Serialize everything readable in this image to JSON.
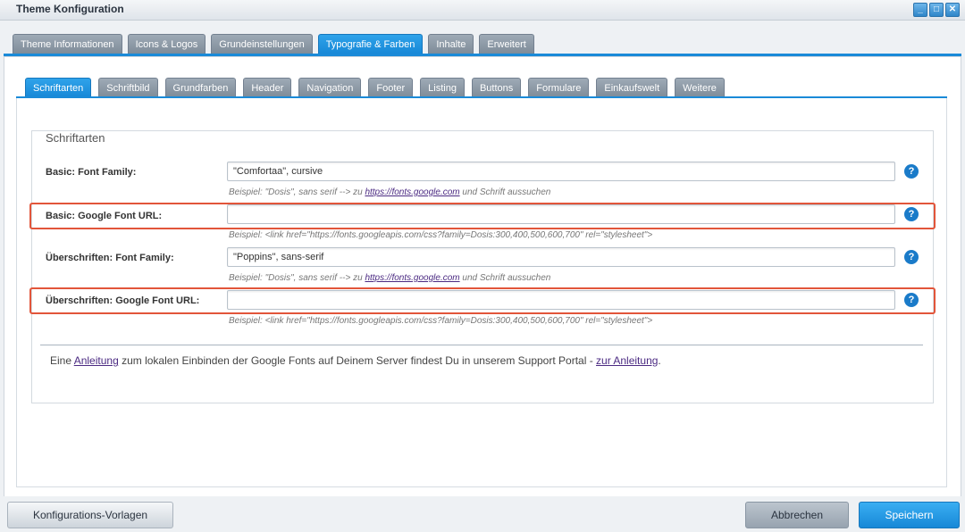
{
  "window": {
    "title": "Theme Konfiguration",
    "controls": [
      "_",
      "□",
      "✕"
    ]
  },
  "main_tabs": [
    "Theme Informationen",
    "Icons & Logos",
    "Grundeinstellungen",
    "Typografie & Farben",
    "Inhalte",
    "Erweitert"
  ],
  "main_tab_active": "Typografie & Farben",
  "sub_tabs": [
    "Schriftarten",
    "Schriftbild",
    "Grundfarben",
    "Header",
    "Navigation",
    "Footer",
    "Listing",
    "Buttons",
    "Formulare",
    "Einkaufswelt",
    "Weitere"
  ],
  "sub_tab_active": "Schriftarten",
  "fieldset_legend": "Schriftarten",
  "fields": [
    {
      "label": "Basic: Font Family:",
      "value": "\"Comfortaa\", cursive",
      "hint_pre": "Beispiel: \"Dosis\", sans serif --> zu ",
      "hint_link": "https://fonts.google.com",
      "hint_post": " und Schrift aussuchen"
    },
    {
      "label": "Basic: Google Font URL:",
      "value": "",
      "hint_pre": "Beispiel: <link href=\"https://fonts.googleapis.com/css?family=Dosis:300,400,500,600,700\" rel=\"stylesheet\">",
      "hint_link": "",
      "hint_post": ""
    },
    {
      "label": "Überschriften: Font Family:",
      "value": "\"Poppins\", sans-serif",
      "hint_pre": "Beispiel: \"Dosis\", sans serif --> zu ",
      "hint_link": "https://fonts.google.com",
      "hint_post": " und Schrift aussuchen"
    },
    {
      "label": "Überschriften: Google Font URL:",
      "value": "",
      "hint_pre": "Beispiel: <link href=\"https://fonts.googleapis.com/css?family=Dosis:300,400,500,600,700\" rel=\"stylesheet\">",
      "hint_link": "",
      "hint_post": ""
    }
  ],
  "help_icon": "?",
  "info": {
    "pre": "Eine ",
    "link1": "Anleitung",
    "mid": " zum lokalen Einbinden der Google Fonts auf Deinem Server findest Du in unserem Support Portal - ",
    "link2": "zur Anleitung",
    "post": "."
  },
  "buttons": {
    "templates": "Konfigurations-Vorlagen",
    "cancel": "Abbrechen",
    "save": "Speichern"
  },
  "colors": {
    "accent": "#1a8ad8",
    "highlight": "#e2553a"
  }
}
